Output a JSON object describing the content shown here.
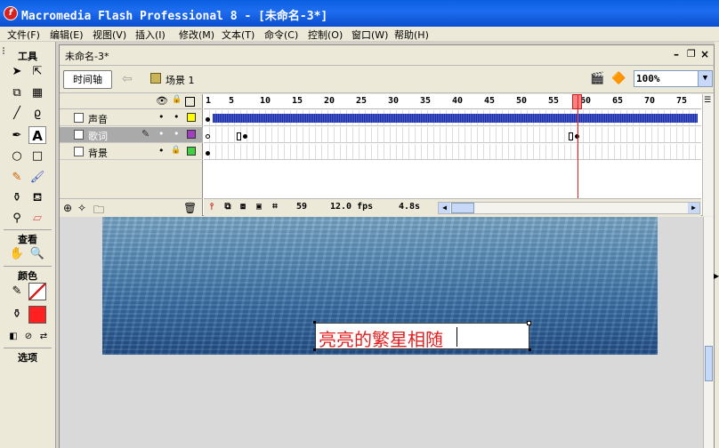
{
  "window": {
    "title": "Macromedia Flash Professional 8 - [未命名-3*]"
  },
  "menu": [
    "文件(F)",
    "编辑(E)",
    "视图(V)",
    "插入(I)",
    "修改(M)",
    "文本(T)",
    "命令(C)",
    "控制(O)",
    "窗口(W)",
    "帮助(H)"
  ],
  "tools": {
    "header": "工具",
    "view_header": "查看",
    "colors_header": "颜色",
    "options_header": "选项",
    "stroke_color": "#000000",
    "fill_color": "#ff2020"
  },
  "document": {
    "tab": "未命名-3*",
    "timeline_button": "时间轴",
    "scene": "场景 1",
    "zoom": "100%"
  },
  "timeline": {
    "ruler": [
      "1",
      "5",
      "10",
      "15",
      "20",
      "25",
      "30",
      "35",
      "40",
      "45",
      "50",
      "55",
      "60",
      "65",
      "70",
      "75"
    ],
    "layers": [
      {
        "name": "声音",
        "color": "#ffff00"
      },
      {
        "name": "歌词",
        "color": "#a040c0"
      },
      {
        "name": "背景",
        "color": "#40d040"
      }
    ],
    "current_frame": "59",
    "fps": "12.0 fps",
    "elapsed": "4.8s"
  },
  "stage": {
    "text": "亮亮的繁星相随"
  }
}
